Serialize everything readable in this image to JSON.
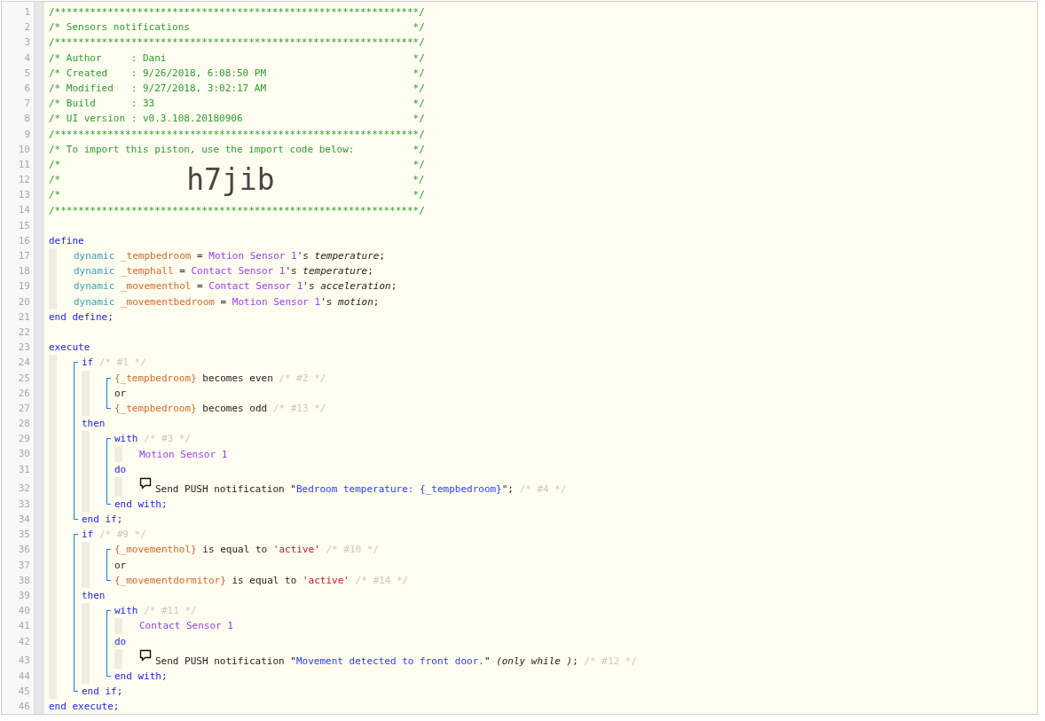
{
  "editor": {
    "lines": [
      {
        "kind": "line",
        "number": "1",
        "tokens": [
          {
            "kind": "comment",
            "text": "/**************************************************************/"
          }
        ]
      },
      {
        "kind": "line",
        "number": "2",
        "tokens": [
          {
            "kind": "comment",
            "text": "/* Sensors notifications                                      */"
          }
        ]
      },
      {
        "kind": "line",
        "number": "3",
        "tokens": [
          {
            "kind": "comment",
            "text": "/**************************************************************/"
          }
        ]
      },
      {
        "kind": "line",
        "number": "4",
        "tokens": [
          {
            "kind": "comment",
            "text": "/* Author     : Dani                                          */"
          }
        ]
      },
      {
        "kind": "line",
        "number": "5",
        "tokens": [
          {
            "kind": "comment",
            "text": "/* Created    : 9/26/2018, 6:08:50 PM                         */"
          }
        ]
      },
      {
        "kind": "line",
        "number": "6",
        "tokens": [
          {
            "kind": "comment",
            "text": "/* Modified   : 9/27/2018, 3:02:17 AM                         */"
          }
        ]
      },
      {
        "kind": "line",
        "number": "7",
        "tokens": [
          {
            "kind": "comment",
            "text": "/* Build      : 33                                            */"
          }
        ]
      },
      {
        "kind": "line",
        "number": "8",
        "tokens": [
          {
            "kind": "comment",
            "text": "/* UI version : v0.3.108.20180906                             */"
          }
        ]
      },
      {
        "kind": "line",
        "number": "9",
        "tokens": [
          {
            "kind": "comment",
            "text": "/**************************************************************/"
          }
        ]
      },
      {
        "kind": "line",
        "number": "10",
        "tokens": [
          {
            "kind": "comment",
            "text": "/* To import this piston, use the import code below:          */"
          }
        ]
      },
      {
        "kind": "line",
        "number": "11",
        "tokens": [
          {
            "kind": "comment",
            "text": "/*                                                            */"
          }
        ]
      },
      {
        "kind": "line",
        "number": "12",
        "tokens": [
          {
            "kind": "comment",
            "text": "/*"
          },
          {
            "kind": "code",
            "text": "h7jib"
          },
          {
            "kind": "comment",
            "text": "*/"
          }
        ]
      },
      {
        "kind": "line",
        "number": "13",
        "tokens": [
          {
            "kind": "comment",
            "text": "/*                                                            */"
          }
        ]
      },
      {
        "kind": "line",
        "number": "14",
        "tokens": [
          {
            "kind": "comment",
            "text": "/**************************************************************/"
          }
        ]
      },
      {
        "kind": "line",
        "number": "15"
      },
      {
        "kind": "line",
        "number": "16",
        "tokens": [
          {
            "kind": "keyword",
            "text": "define"
          }
        ]
      },
      {
        "kind": "indent",
        "children": [
          {
            "kind": "line",
            "number": "17",
            "tokens": [
              {
                "kind": "type",
                "text": "dynamic "
              },
              {
                "kind": "variable",
                "text": "_tempbedroom"
              },
              {
                "kind": "plain",
                "text": " = "
              },
              {
                "kind": "device",
                "text": "Motion Sensor 1"
              },
              {
                "kind": "plain",
                "text": "'s "
              },
              {
                "kind": "attr",
                "text": "temperature"
              },
              {
                "kind": "plain",
                "text": ";"
              }
            ]
          },
          {
            "kind": "line",
            "number": "18",
            "tokens": [
              {
                "kind": "type",
                "text": "dynamic "
              },
              {
                "kind": "variable",
                "text": "_temphall"
              },
              {
                "kind": "plain",
                "text": " = "
              },
              {
                "kind": "device",
                "text": "Contact Sensor 1"
              },
              {
                "kind": "plain",
                "text": "'s "
              },
              {
                "kind": "attr",
                "text": "temperature"
              },
              {
                "kind": "plain",
                "text": ";"
              }
            ]
          },
          {
            "kind": "line",
            "number": "19",
            "tokens": [
              {
                "kind": "type",
                "text": "dynamic "
              },
              {
                "kind": "variable",
                "text": "_movementhol"
              },
              {
                "kind": "plain",
                "text": " = "
              },
              {
                "kind": "device",
                "text": "Contact Sensor 1"
              },
              {
                "kind": "plain",
                "text": "'s "
              },
              {
                "kind": "attr",
                "text": "acceleration"
              },
              {
                "kind": "plain",
                "text": ";"
              }
            ]
          },
          {
            "kind": "line",
            "number": "20",
            "tokens": [
              {
                "kind": "type",
                "text": "dynamic "
              },
              {
                "kind": "variable",
                "text": "_movementbedroom"
              },
              {
                "kind": "plain",
                "text": " = "
              },
              {
                "kind": "device",
                "text": "Motion Sensor 1"
              },
              {
                "kind": "plain",
                "text": "'s "
              },
              {
                "kind": "attr",
                "text": "motion"
              },
              {
                "kind": "plain",
                "text": ";"
              }
            ]
          }
        ]
      },
      {
        "kind": "line",
        "number": "21",
        "tokens": [
          {
            "kind": "keyword",
            "text": "end define;"
          }
        ]
      },
      {
        "kind": "line",
        "number": "22"
      },
      {
        "kind": "line",
        "number": "23",
        "tokens": [
          {
            "kind": "keyword",
            "text": "execute"
          }
        ]
      },
      {
        "kind": "indent",
        "children": [
          {
            "kind": "group",
            "children": [
              {
                "kind": "line",
                "number": "24",
                "tokens": [
                  {
                    "kind": "keyword",
                    "text": "if "
                  },
                  {
                    "kind": "note",
                    "text": "/* #1 */"
                  }
                ]
              },
              {
                "kind": "indent",
                "children": [
                  {
                    "kind": "group",
                    "children": [
                      {
                        "kind": "line",
                        "number": "25",
                        "tokens": [
                          {
                            "kind": "variable",
                            "text": "{_tempbedroom}"
                          },
                          {
                            "kind": "plain",
                            "text": " becomes even "
                          },
                          {
                            "kind": "note",
                            "text": "/* #2 */"
                          }
                        ]
                      },
                      {
                        "kind": "line",
                        "number": "26",
                        "tokens": [
                          {
                            "kind": "plain",
                            "text": "or"
                          }
                        ]
                      },
                      {
                        "kind": "line",
                        "number": "27",
                        "tokens": [
                          {
                            "kind": "variable",
                            "text": "{_tempbedroom}"
                          },
                          {
                            "kind": "plain",
                            "text": " becomes odd "
                          },
                          {
                            "kind": "note",
                            "text": "/* #13 */"
                          }
                        ]
                      }
                    ]
                  }
                ]
              },
              {
                "kind": "line",
                "number": "28",
                "tokens": [
                  {
                    "kind": "keyword",
                    "text": "then"
                  }
                ]
              },
              {
                "kind": "indent",
                "children": [
                  {
                    "kind": "group",
                    "children": [
                      {
                        "kind": "line",
                        "number": "29",
                        "tokens": [
                          {
                            "kind": "keyword",
                            "text": "with "
                          },
                          {
                            "kind": "note",
                            "text": "/* #3 */"
                          }
                        ]
                      },
                      {
                        "kind": "indent",
                        "children": [
                          {
                            "kind": "line",
                            "number": "30",
                            "tokens": [
                              {
                                "kind": "device",
                                "text": "Motion Sensor 1"
                              }
                            ]
                          }
                        ]
                      },
                      {
                        "kind": "line",
                        "number": "31",
                        "tokens": [
                          {
                            "kind": "keyword",
                            "text": "do"
                          }
                        ]
                      },
                      {
                        "kind": "indent",
                        "children": [
                          {
                            "kind": "line",
                            "number": "32",
                            "tokens": [
                              {
                                "kind": "icon"
                              },
                              {
                                "kind": "plain",
                                "text": "Send PUSH notification \""
                              },
                              {
                                "kind": "string",
                                "text": "Bedroom temperature: {_tempbedroom}"
                              },
                              {
                                "kind": "plain",
                                "text": "\"; "
                              },
                              {
                                "kind": "note",
                                "text": "/* #4 */"
                              }
                            ]
                          }
                        ]
                      },
                      {
                        "kind": "line",
                        "number": "33",
                        "tokens": [
                          {
                            "kind": "keyword",
                            "text": "end with;"
                          }
                        ]
                      }
                    ]
                  }
                ]
              },
              {
                "kind": "line",
                "number": "34",
                "tokens": [
                  {
                    "kind": "keyword",
                    "text": "end if;"
                  }
                ]
              }
            ]
          },
          {
            "kind": "group",
            "children": [
              {
                "kind": "line",
                "number": "35",
                "tokens": [
                  {
                    "kind": "keyword",
                    "text": "if "
                  },
                  {
                    "kind": "note",
                    "text": "/* #9 */"
                  }
                ]
              },
              {
                "kind": "indent",
                "children": [
                  {
                    "kind": "group",
                    "children": [
                      {
                        "kind": "line",
                        "number": "36",
                        "tokens": [
                          {
                            "kind": "variable",
                            "text": "{_movementhol}"
                          },
                          {
                            "kind": "plain",
                            "text": " is equal to "
                          },
                          {
                            "kind": "literal",
                            "text": "'active'"
                          },
                          {
                            "kind": "note",
                            "text": " /* #10 */"
                          }
                        ]
                      },
                      {
                        "kind": "line",
                        "number": "37",
                        "tokens": [
                          {
                            "kind": "plain",
                            "text": "or"
                          }
                        ]
                      },
                      {
                        "kind": "line",
                        "number": "38",
                        "tokens": [
                          {
                            "kind": "variable",
                            "text": "{_movementdormitor}"
                          },
                          {
                            "kind": "plain",
                            "text": " is equal to "
                          },
                          {
                            "kind": "literal",
                            "text": "'active'"
                          },
                          {
                            "kind": "note",
                            "text": " /* #14 */"
                          }
                        ]
                      }
                    ]
                  }
                ]
              },
              {
                "kind": "line",
                "number": "39",
                "tokens": [
                  {
                    "kind": "keyword",
                    "text": "then"
                  }
                ]
              },
              {
                "kind": "indent",
                "children": [
                  {
                    "kind": "group",
                    "children": [
                      {
                        "kind": "line",
                        "number": "40",
                        "tokens": [
                          {
                            "kind": "keyword",
                            "text": "with "
                          },
                          {
                            "kind": "note",
                            "text": "/* #11 */"
                          }
                        ]
                      },
                      {
                        "kind": "indent",
                        "children": [
                          {
                            "kind": "line",
                            "number": "41",
                            "tokens": [
                              {
                                "kind": "device",
                                "text": "Contact Sensor 1"
                              }
                            ]
                          }
                        ]
                      },
                      {
                        "kind": "line",
                        "number": "42",
                        "tokens": [
                          {
                            "kind": "keyword",
                            "text": "do"
                          }
                        ]
                      },
                      {
                        "kind": "indent",
                        "children": [
                          {
                            "kind": "line",
                            "number": "43",
                            "tokens": [
                              {
                                "kind": "icon"
                              },
                              {
                                "kind": "plain",
                                "text": "Send PUSH notification \""
                              },
                              {
                                "kind": "string",
                                "text": "Movement detected to front door."
                              },
                              {
                                "kind": "plain",
                                "text": "\" "
                              },
                              {
                                "kind": "attr",
                                "text": "(only while )"
                              },
                              {
                                "kind": "plain",
                                "text": "; "
                              },
                              {
                                "kind": "note",
                                "text": "/* #12 */"
                              }
                            ]
                          }
                        ]
                      },
                      {
                        "kind": "line",
                        "number": "44",
                        "tokens": [
                          {
                            "kind": "keyword",
                            "text": "end with;"
                          }
                        ]
                      }
                    ]
                  }
                ]
              },
              {
                "kind": "line",
                "number": "45",
                "tokens": [
                  {
                    "kind": "keyword",
                    "text": "end if;"
                  }
                ]
              }
            ]
          }
        ]
      },
      {
        "kind": "line",
        "number": "46",
        "tokens": [
          {
            "kind": "keyword",
            "text": "end execute;"
          }
        ]
      }
    ]
  }
}
